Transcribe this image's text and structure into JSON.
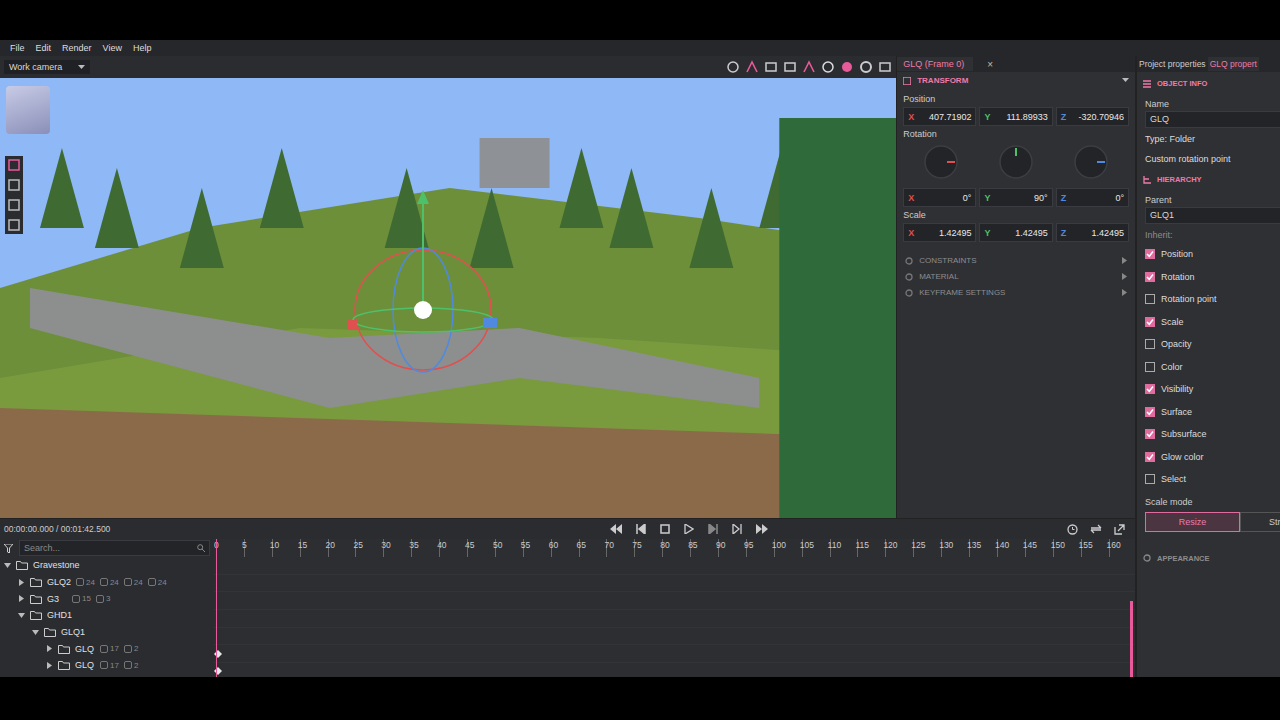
{
  "menu": [
    "File",
    "Edit",
    "Render",
    "View",
    "Help"
  ],
  "camera": {
    "label": "Work camera"
  },
  "inspector": {
    "tab": "GLQ (Frame 0)",
    "close": "×",
    "section": "TRANSFORM",
    "position": {
      "label": "Position",
      "values": [
        {
          "axis": "X",
          "value": "407.71902",
          "color": "#e0504f"
        },
        {
          "axis": "Y",
          "value": "111.89933",
          "color": "#4fc06a"
        },
        {
          "axis": "Z",
          "value": "-320.70946",
          "color": "#4f8ae0"
        }
      ]
    },
    "rotation": {
      "label": "Rotation",
      "values": [
        {
          "axis": "X",
          "value": "0°",
          "color": "#e0504f"
        },
        {
          "axis": "Y",
          "value": "90°",
          "color": "#4fc06a"
        },
        {
          "axis": "Z",
          "value": "0°",
          "color": "#4f8ae0"
        }
      ]
    },
    "scale": {
      "label": "Scale",
      "values": [
        {
          "axis": "X",
          "value": "1.42495",
          "color": "#e0504f"
        },
        {
          "axis": "Y",
          "value": "1.42495",
          "color": "#4fc06a"
        },
        {
          "axis": "Z",
          "value": "1.42495",
          "color": "#4f8ae0"
        }
      ]
    },
    "collapsed": [
      "CONSTRAINTS",
      "MATERIAL",
      "KEYFRAME SETTINGS"
    ]
  },
  "properties": {
    "tabs": [
      {
        "label": "Project properties",
        "selected": false
      },
      {
        "label": "GLQ propert",
        "selected": true
      }
    ],
    "object_info": "OBJECT INFO",
    "name_label": "Name",
    "name": "GLQ",
    "type": "Type: Folder",
    "custom_rotation_point": "Custom rotation point",
    "hierarchy": "HIERARCHY",
    "parent_label": "Parent",
    "parent": "GLQ1",
    "inherit_label": "Inherit:",
    "inherit": [
      {
        "label": "Position",
        "checked": true
      },
      {
        "label": "Rotation",
        "checked": true
      },
      {
        "label": "Rotation point",
        "checked": false
      },
      {
        "label": "Scale",
        "checked": true
      },
      {
        "label": "Opacity",
        "checked": false
      },
      {
        "label": "Color",
        "checked": false
      },
      {
        "label": "Visibility",
        "checked": true
      },
      {
        "label": "Surface",
        "checked": true
      },
      {
        "label": "Subsurface",
        "checked": true
      },
      {
        "label": "Glow color",
        "checked": true
      },
      {
        "label": "Select",
        "checked": false
      }
    ],
    "scale_mode_label": "Scale mode",
    "scale_modes": [
      {
        "label": "Resize",
        "selected": true
      },
      {
        "label": "Str",
        "selected": false
      }
    ],
    "appearance": "APPEARANCE"
  },
  "timeline": {
    "time": "00:00:00.000 / 00:01:42.500",
    "search_placeholder": "Search...",
    "ticks": [
      "0",
      "5",
      "10",
      "15",
      "20",
      "25",
      "30",
      "35",
      "40",
      "45",
      "50",
      "55",
      "60",
      "65",
      "70",
      "75",
      "80",
      "85",
      "90",
      "95",
      "100",
      "105",
      "110",
      "115",
      "120",
      "125",
      "130",
      "135",
      "140",
      "145",
      "150",
      "155",
      "160"
    ],
    "tree": [
      {
        "name": "Gravestone",
        "depth": 0,
        "expanded": true,
        "counts": [],
        "keyframe": false
      },
      {
        "name": "GLQ2",
        "depth": 1,
        "expanded": false,
        "counts": [
          "24",
          "24",
          "24",
          "24"
        ],
        "keyframe": false
      },
      {
        "name": "G3",
        "depth": 1,
        "expanded": false,
        "counts": [
          "15",
          "3"
        ],
        "keyframe": false
      },
      {
        "name": "GHD1",
        "depth": 1,
        "expanded": true,
        "counts": [],
        "keyframe": false
      },
      {
        "name": "GLQ1",
        "depth": 2,
        "expanded": true,
        "counts": [],
        "keyframe": false
      },
      {
        "name": "GLQ",
        "depth": 3,
        "expanded": false,
        "counts": [
          "17",
          "2"
        ],
        "keyframe": true
      },
      {
        "name": "GLQ",
        "depth": 3,
        "expanded": false,
        "counts": [
          "17",
          "2"
        ],
        "keyframe": true
      }
    ]
  }
}
